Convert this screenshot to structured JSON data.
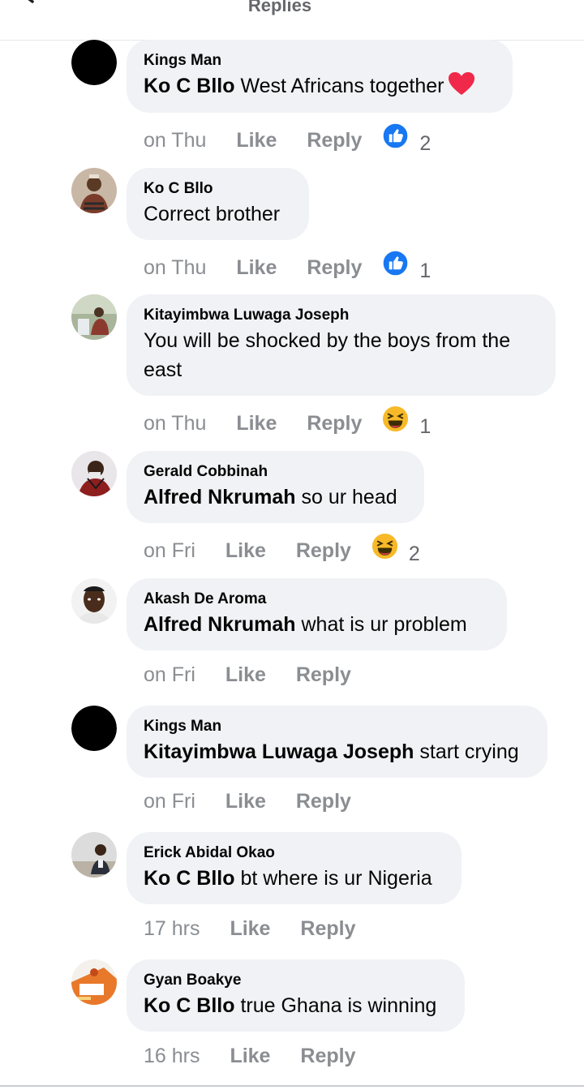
{
  "header": {
    "title": "Replies"
  },
  "colors": {
    "like_blue": "#1877f2",
    "haha_yellow": "#f7b928",
    "heart_red": "#f02849",
    "bubble_bg": "#f0f2f5",
    "meta_gray": "#8a8d91"
  },
  "action_labels": {
    "like": "Like",
    "reply": "Reply"
  },
  "comments": [
    {
      "author": "Kings Man",
      "mention": "Ko C Bllo",
      "text": " West Africans together",
      "emoji": "heart",
      "time": "on Thu",
      "reaction": "like",
      "reaction_count": "2"
    },
    {
      "author": "Ko C Bllo",
      "mention": "",
      "text": "Correct brother",
      "time": "on Thu",
      "reaction": "like",
      "reaction_count": "1"
    },
    {
      "author": "Kitayimbwa Luwaga Joseph",
      "mention": "",
      "text": "You will be shocked by the boys from the east",
      "time": "on Thu",
      "reaction": "haha",
      "reaction_count": "1"
    },
    {
      "author": "Gerald Cobbinah",
      "mention": "Alfred Nkrumah",
      "text": " so ur head",
      "time": "on Fri",
      "reaction": "haha",
      "reaction_count": "2"
    },
    {
      "author": "Akash De Aroma",
      "mention": "Alfred Nkrumah",
      "text": " what is ur problem",
      "time": "on Fri",
      "reaction": "",
      "reaction_count": ""
    },
    {
      "author": "Kings Man",
      "mention": "Kitayimbwa Luwaga Joseph",
      "text": " start crying",
      "time": "on Fri",
      "reaction": "",
      "reaction_count": ""
    },
    {
      "author": "Erick Abidal Okao",
      "mention": "Ko C Bllo",
      "text": " bt where is ur Nigeria",
      "time": "17 hrs",
      "reaction": "",
      "reaction_count": ""
    },
    {
      "author": "Gyan Boakye",
      "mention": "Ko C Bllo",
      "text": " true Ghana is winning",
      "time": "16 hrs",
      "reaction": "",
      "reaction_count": ""
    }
  ]
}
